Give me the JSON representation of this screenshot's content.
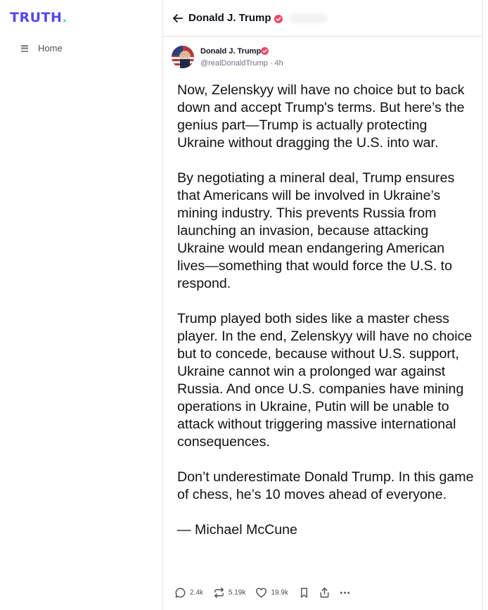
{
  "brand": {
    "logo_text": "TRUTH",
    "logo_dot": ".",
    "colors": {
      "primary": "#5448ee",
      "accent": "#5cd6c0",
      "verified": "#f04a6a"
    }
  },
  "sidebar": {
    "items": [
      {
        "label": "Home",
        "icon": "home-list-icon"
      }
    ]
  },
  "header": {
    "back_icon": "arrow-left-icon",
    "title": "Donald J. Trump",
    "verified_icon": "verified-badge-icon"
  },
  "post": {
    "author": {
      "name": "Donald J. Trump",
      "handle": "@realDonaldTrump",
      "separator": "·",
      "time": "4h"
    },
    "paragraphs": [
      "Now, Zelenskyy will have no choice but to back down and accept Trump's terms. But here’s the genius part—Trump is actually protecting Ukraine without dragging the U.S. into war.",
      "By negotiating a mineral deal, Trump ensures that Americans will be involved in Ukraine’s mining industry. This prevents Russia from launching an invasion, because attacking Ukraine would mean endangering American lives—something that would force the U.S. to respond.",
      "Trump played both sides like a master chess player. In the end, Zelenskyy will have no choice but to concede, because without U.S. support, Ukraine cannot win a prolonged war against Russia. And once U.S. companies have mining operations in Ukraine, Putin will be unable to attack without triggering massive international consequences.",
      "Don’t underestimate Donald Trump. In this game of chess, he’s 10 moves ahead of everyone.",
      "— Michael McCune"
    ],
    "actions": {
      "replies": "2.4k",
      "retruths": "5.19k",
      "likes": "19.9k",
      "icons": [
        "comment-icon",
        "retruth-icon",
        "heart-icon",
        "bookmark-icon",
        "share-icon",
        "more-icon"
      ]
    }
  }
}
